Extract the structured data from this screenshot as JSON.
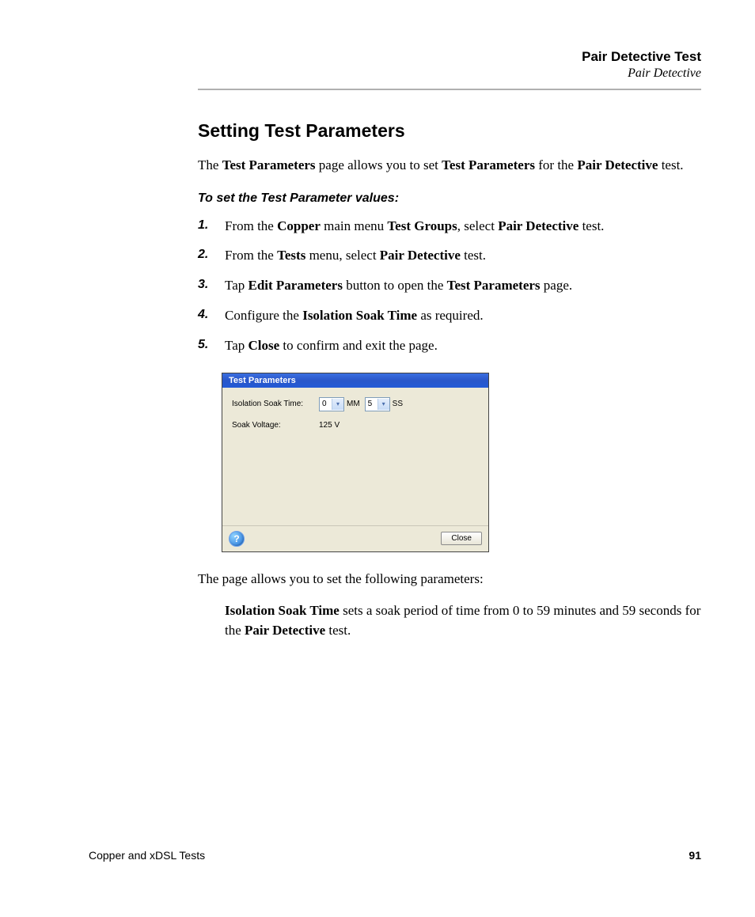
{
  "header": {
    "chapter": "Pair Detective Test",
    "section": "Pair Detective"
  },
  "heading": "Setting Test Parameters",
  "intro": {
    "t1": "The ",
    "b1": "Test Parameters",
    "t2": " page allows you to set ",
    "b2": "Test Parameters",
    "t3": " for the ",
    "b3": "Pair Detective",
    "t4": " test."
  },
  "procedure_title": "To set the Test Parameter values:",
  "steps": [
    {
      "num": "1.",
      "pre": "From the ",
      "b1": "Copper",
      "mid1": " main menu ",
      "b2": "Test Groups",
      "mid2": ", select ",
      "b3": "Pair Detective",
      "post": " test."
    },
    {
      "num": "2.",
      "pre": "From the ",
      "b1": "Tests",
      "mid1": " menu, select ",
      "b2": "Pair Detective",
      "mid2": "",
      "b3": "",
      "post": " test."
    },
    {
      "num": "3.",
      "pre": "Tap ",
      "b1": "Edit Parameters",
      "mid1": " button to open the ",
      "b2": "Test Parameters",
      "mid2": "",
      "b3": "",
      "post": " page."
    },
    {
      "num": "4.",
      "pre": "Configure the ",
      "b1": "Isolation Soak Time",
      "mid1": " as required.",
      "b2": "",
      "mid2": "",
      "b3": "",
      "post": ""
    },
    {
      "num": "5.",
      "pre": "Tap ",
      "b1": "Close",
      "mid1": " to confirm and exit the page.",
      "b2": "",
      "mid2": "",
      "b3": "",
      "post": ""
    }
  ],
  "dialog": {
    "title": "Test Parameters",
    "row1_label": "Isolation Soak Time:",
    "mm_value": "0",
    "mm_unit": "MM",
    "ss_value": "5",
    "ss_unit": "SS",
    "row2_label": "Soak Voltage:",
    "row2_value": "125 V",
    "help": "?",
    "close": "Close"
  },
  "after_text": "The page allows you to set the following parameters:",
  "param_desc": {
    "b1": "Isolation Soak Time",
    "t1": " sets a soak period of time from 0 to 59 minutes and 59 seconds for the ",
    "b2": "Pair Detective",
    "t2": " test."
  },
  "footer": {
    "book": "Copper and xDSL Tests",
    "page": "91"
  }
}
